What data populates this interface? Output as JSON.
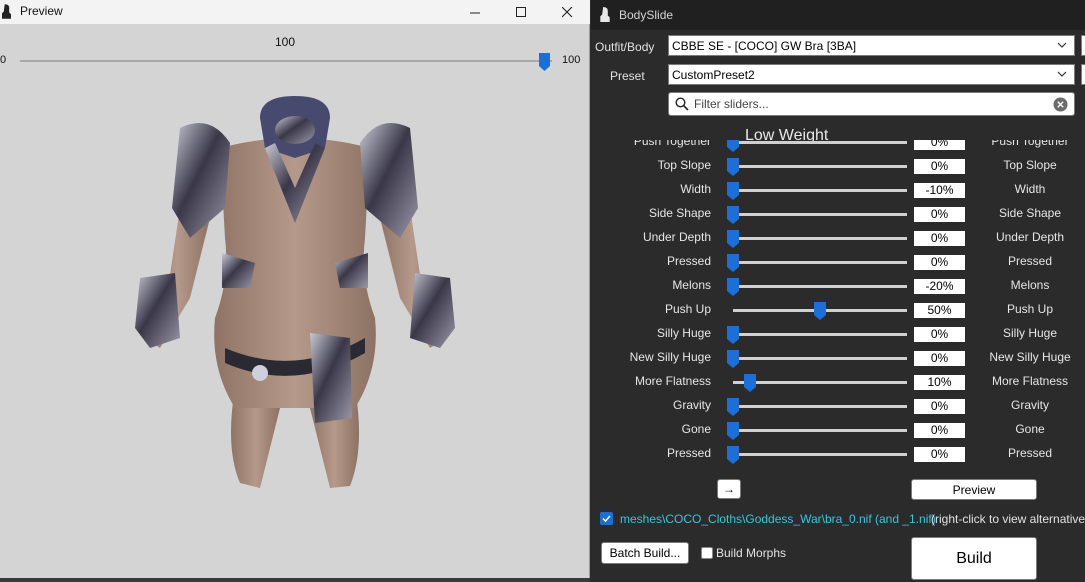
{
  "preview": {
    "title": "Preview",
    "slider_value": "100",
    "slider_min": "0",
    "slider_max": "100",
    "slider_level": 1.0,
    "icons": {
      "app": "bodyslide-icon",
      "minimize": "minimize-icon",
      "maximize": "maximize-icon",
      "close": "close-icon"
    }
  },
  "bodyslide": {
    "title": "BodySlide",
    "outfit_label": "Outfit/Body",
    "outfit_value": "CBBE SE - [COCO] GW Bra [3BA]",
    "preset_label": "Preset",
    "preset_value": "CustomPreset2",
    "search_placeholder": "Filter sliders...",
    "group_title": "Low Weight",
    "sliders": [
      {
        "name": "Push Together",
        "value": "0%",
        "level": 0.0
      },
      {
        "name": "Top Slope",
        "value": "0%",
        "level": 0.0
      },
      {
        "name": "Width",
        "value": "-10%",
        "level": 0.0
      },
      {
        "name": "Side Shape",
        "value": "0%",
        "level": 0.0
      },
      {
        "name": "Under Depth",
        "value": "0%",
        "level": 0.0
      },
      {
        "name": "Pressed",
        "value": "0%",
        "level": 0.0
      },
      {
        "name": "Melons",
        "value": "-20%",
        "level": 0.0
      },
      {
        "name": "Push Up",
        "value": "50%",
        "level": 0.5
      },
      {
        "name": "Silly Huge",
        "value": "0%",
        "level": 0.0
      },
      {
        "name": "New Silly Huge",
        "value": "0%",
        "level": 0.0
      },
      {
        "name": "More Flatness",
        "value": "10%",
        "level": 0.1
      },
      {
        "name": "Gravity",
        "value": "0%",
        "level": 0.0
      },
      {
        "name": "Gone",
        "value": "0%",
        "level": 0.0
      },
      {
        "name": "Pressed",
        "value": "0%",
        "level": 0.0
      }
    ],
    "arrow_button": "→",
    "preview_button": "Preview",
    "file_path": "meshes\\COCO_Cloths\\Goddess_War\\bra_0.nif (and _1.nif)",
    "file_hint": "(right-click to view alternatives)",
    "batch_build_button": "Batch Build...",
    "build_morphs_label": "Build Morphs",
    "build_button": "Build",
    "colors": {
      "accent": "#1a6fd8",
      "path_text": "#35c6e3",
      "panel_bg": "#2b2b2b"
    }
  }
}
